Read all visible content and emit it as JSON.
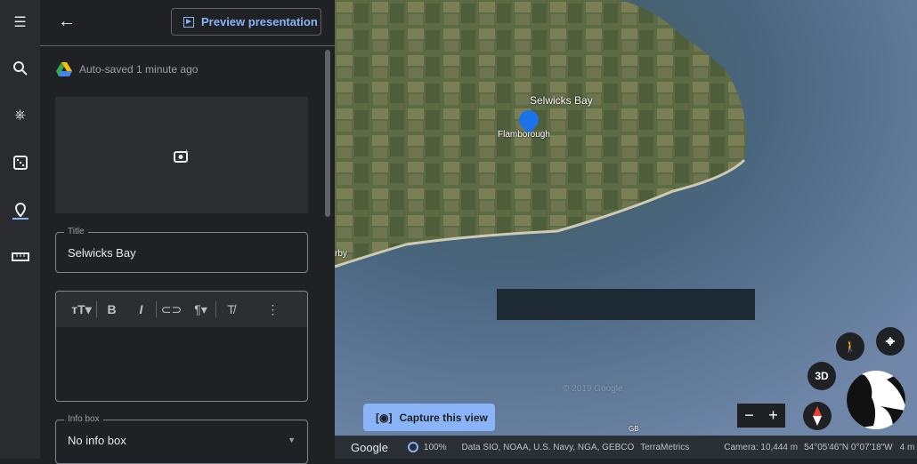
{
  "rail": {
    "icons": [
      "menu-icon",
      "search-icon",
      "voyager-icon",
      "feeling-lucky-icon",
      "projects-icon",
      "measure-icon"
    ]
  },
  "panel": {
    "preview_label": "Preview presentation",
    "autosave": "Auto-saved 1 minute ago",
    "title_label": "Title",
    "title_value": "Selwicks Bay",
    "toolbar": [
      "text-size",
      "bold",
      "italic",
      "link",
      "paragraph",
      "clear-format",
      "more"
    ],
    "infobox_label": "Info box",
    "infobox_value": "No info box"
  },
  "map": {
    "place_label": "Selwicks Bay",
    "town_label": "Flamborough",
    "left_label": "rby",
    "watermark": "© 2019 Google",
    "country": "GB",
    "capture_label": "Capture this view",
    "btn_3d": "3D"
  },
  "status": {
    "brand": "Google",
    "load": "100%",
    "attribution": "Data SIO, NOAA, U.S. Navy, NGA, GEBCO",
    "terra": "TerraMetrics",
    "camera": "Camera: 10,444 m",
    "coords": "54°05'46\"N 0°07'18\"W",
    "scale": "4 m"
  },
  "colors": {
    "accent": "#8ab4f8",
    "panel": "#202124"
  }
}
